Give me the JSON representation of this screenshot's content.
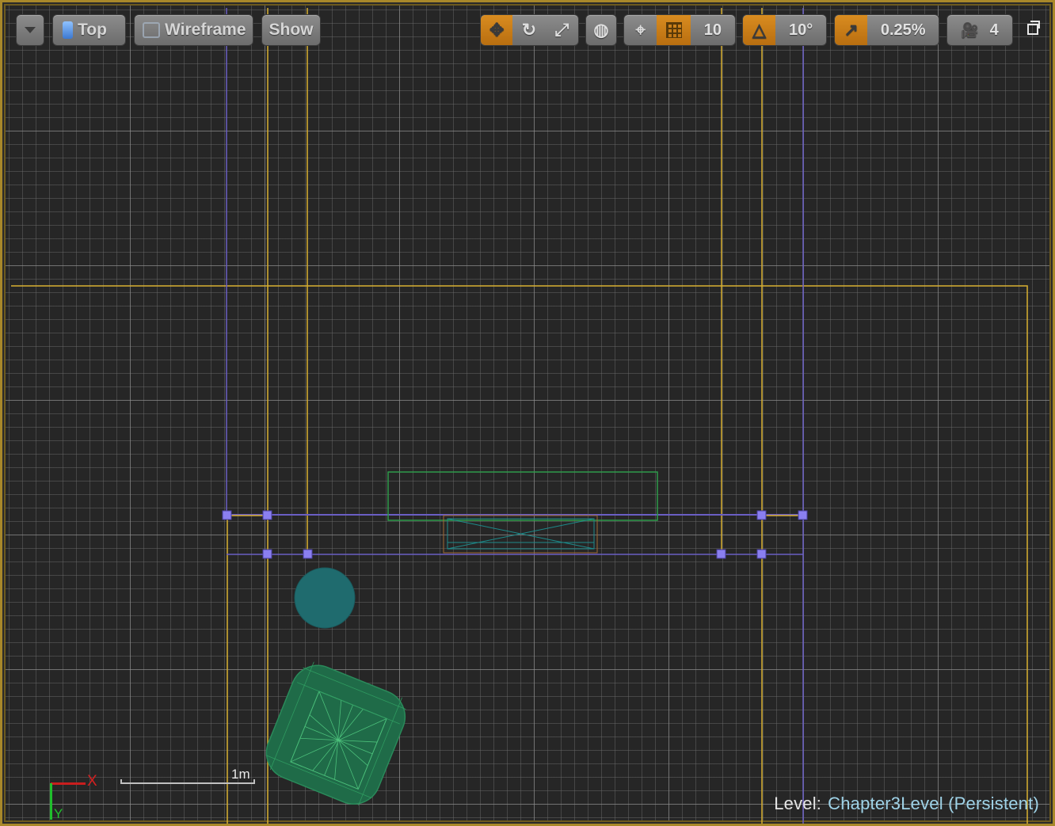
{
  "toolbar": {
    "view_menu_icon": "chevron-down-icon",
    "viewport_type_label": "Top",
    "view_mode_label": "Wireframe",
    "show_label": "Show",
    "translate_icon": "move-icon",
    "rotate_icon": "rotate-icon",
    "scale_icon": "scale-icon",
    "coordinate_space_icon": "globe-icon",
    "surface_snap_icon": "surface-snap-icon",
    "grid_snap_icon": "grid-icon",
    "grid_snap_value": "10",
    "rotation_snap_icon": "angle-icon",
    "rotation_snap_value": "10°",
    "scale_snap_icon": "scale-arrow-icon",
    "scale_snap_value": "0.25%",
    "camera_speed_icon": "camera-speed-icon",
    "camera_speed_value": "4",
    "maximize_icon": "maximize-icon",
    "accent_color": "#d98c20"
  },
  "viewport": {
    "scale_label": "1m",
    "axis_x_label": "X",
    "axis_y_label": "Y",
    "level_prefix": "Level:",
    "level_name": "Chapter3Level (Persistent)",
    "colors": {
      "background": "#262626",
      "selection_lines": "#d8b030",
      "blueprint_lines": "#6a5ec4",
      "mesh_green": "#1f6b48",
      "sphere_teal": "#1f6b6e"
    }
  }
}
